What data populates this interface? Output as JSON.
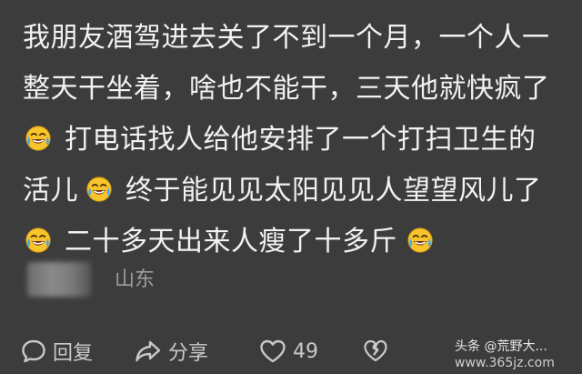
{
  "comment": {
    "line1": "我朋友酒驾进去关了不到一个月，一个人一",
    "line2": "整天干坐着，啥也不能干，三天他就快疯了",
    "line3": "打电话找人给他安排了一个打扫卫生的",
    "line4a": "活儿",
    "line4b": "终于能见见太阳见见人望望风儿了",
    "line5": "二十多天出来人瘦了十多斤",
    "emoji_icon": "laughing-crying-emoji-icon"
  },
  "meta": {
    "username_hidden": true,
    "location": "山东"
  },
  "actions": {
    "reply_label": "回复",
    "share_label": "分享",
    "like_count": "49"
  },
  "watermark": {
    "text": "头条 @荒野大...",
    "site": "www.365jz.com"
  },
  "colors": {
    "background": "#3c3c3c",
    "text": "#f2f2f2",
    "muted": "#9d9d9d",
    "emoji_yellow": "#f7c52b"
  }
}
